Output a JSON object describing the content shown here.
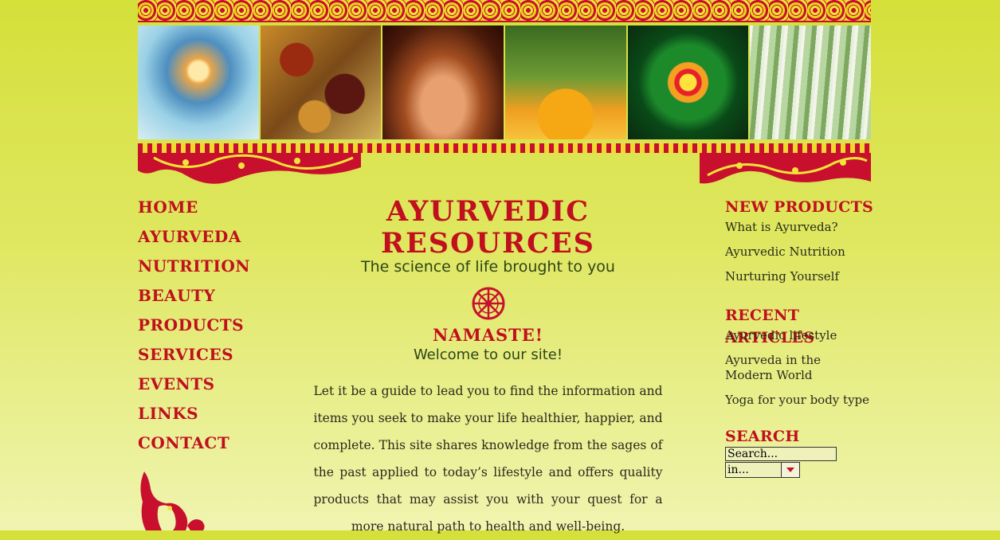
{
  "header": {
    "banner_images": [
      {
        "name": "meditation-chakra-image"
      },
      {
        "name": "spices-image"
      },
      {
        "name": "shirodhara-treatment-image"
      },
      {
        "name": "butterfly-flower-image"
      },
      {
        "name": "mandala-image"
      },
      {
        "name": "birch-forest-image"
      }
    ]
  },
  "nav": {
    "items": [
      {
        "label": "HOME"
      },
      {
        "label": "AYURVEDA"
      },
      {
        "label": "NUTRITION"
      },
      {
        "label": "BEAUTY"
      },
      {
        "label": "PRODUCTS"
      },
      {
        "label": "SERVICES"
      },
      {
        "label": "EVENTS"
      },
      {
        "label": "LINKS"
      },
      {
        "label": "CONTACT"
      }
    ]
  },
  "main": {
    "title": "AYURVEDIC RESOURCES",
    "tagline": "The science of life brought to you",
    "greeting": "NAMASTE!",
    "welcome": "Welcome to our site!",
    "intro": "Let it be a guide to lead you to find the information and items you seek to make your life healthier, happier, and complete. This site shares knowledge from the sages of the past applied to today’s lifestyle and offers quality products that may assist you with your quest for a more natural path to health and well-being."
  },
  "sidebar": {
    "new_products": {
      "heading": "NEW PRODUCTS",
      "items": [
        "What is Ayurveda?",
        "Ayurvedic Nutrition",
        "Nurturing Yourself"
      ]
    },
    "recent_articles": {
      "heading": "RECENT ARTICLES",
      "items": [
        "Ayurvedic lifestyle",
        "Ayurveda in the Modern World",
        "Yoga for your body type"
      ]
    },
    "search": {
      "heading": "SEARCH",
      "input_value": "Search...",
      "scope_value": "in..."
    }
  },
  "colors": {
    "accent_red": "#c0101e",
    "text_green": "#2e4418",
    "background_yellow_green": "#d5e03a"
  }
}
